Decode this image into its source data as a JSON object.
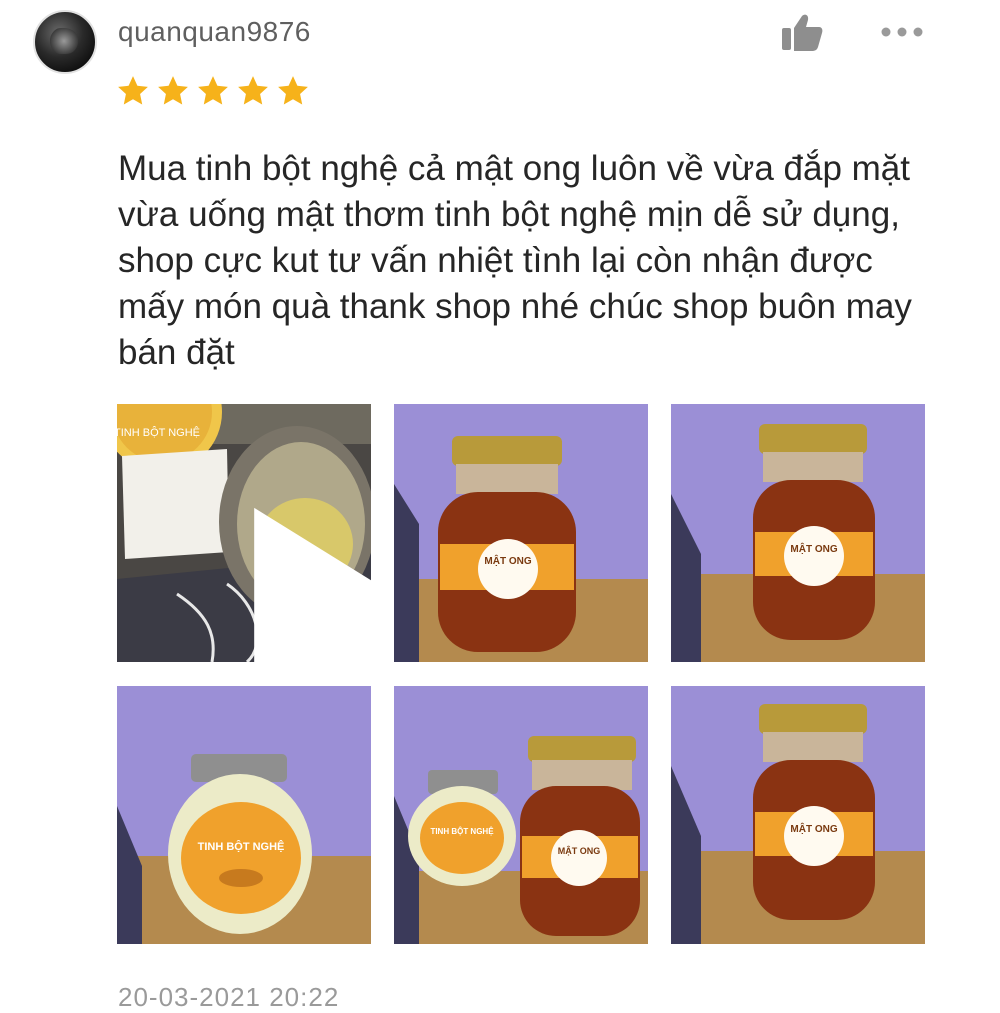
{
  "review": {
    "user": {
      "name": "quanquan9876",
      "avatar_icon": "user-avatar"
    },
    "rating": 5,
    "rating_max": 5,
    "text": "Mua tinh bột nghệ cả mật ong luôn về vừa đắp mặt vừa uống mật thơm tinh bột nghệ mịn dễ sử dụng, shop cực kut tư vấn nhiệt tình lại còn nhận được mấy món quà thank shop nhé chúc shop buôn may bán đặt",
    "date": "20-03-2021 20:22",
    "actions": {
      "like_icon": "thumbs-up-icon",
      "more_icon": "more-options-icon"
    },
    "media": [
      {
        "type": "video",
        "label": "TINH BỘT NGHỆ",
        "icon": "play-icon"
      },
      {
        "type": "image",
        "label": "MẬT ONG"
      },
      {
        "type": "image",
        "label": "MẬT ONG"
      },
      {
        "type": "image",
        "label": "TINH BỘT NGHỆ"
      },
      {
        "type": "image",
        "label": "MẬT ONG",
        "label2": "TINH BỘT NGHỆ"
      },
      {
        "type": "image",
        "label": "MẬT ONG"
      }
    ]
  },
  "colors": {
    "star": "#f6b21a",
    "username": "#5f5f5f",
    "text": "#262626",
    "date": "#9a9a9a",
    "wall": "#9b8fd6",
    "honey": "#8a3312",
    "label": "#f0a12c",
    "lid": "#b89a3a"
  }
}
